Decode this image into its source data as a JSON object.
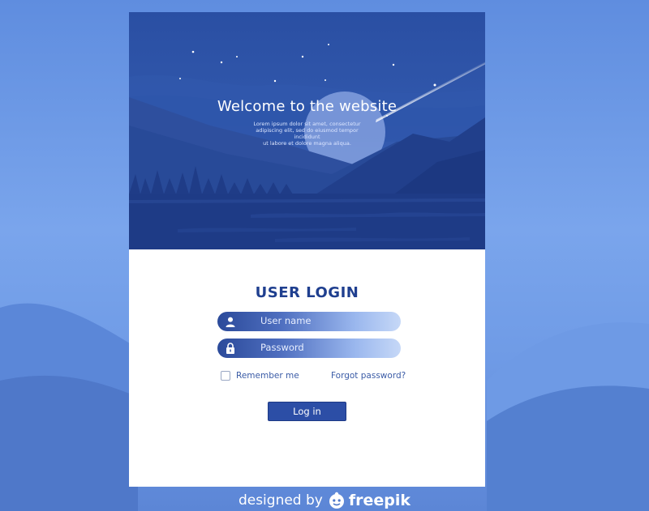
{
  "hero": {
    "title": "Welcome to the website",
    "subtitle_line1": "Lorem ipsum dolor sit amet, consectetur",
    "subtitle_line2": "adipiscing elit, sed do eiusmod tempor incididunt",
    "subtitle_line3": "ut labore et dolore magna aliqua."
  },
  "login": {
    "title": "USER LOGIN",
    "username_placeholder": "User name",
    "password_placeholder": "Password",
    "remember_label": "Remember me",
    "forgot_label": "Forgot password?",
    "submit_label": "Log in"
  },
  "credit": {
    "prefix": "designed by",
    "brand": "freepik"
  },
  "icons": {
    "username": "user-icon",
    "password": "lock-icon",
    "brand": "freepik-logo-icon"
  },
  "colors": {
    "background": "#6a97e3",
    "title": "#1f3f8f",
    "button": "#2c4ea6",
    "link": "#3a5ba6",
    "card": "#ffffff"
  }
}
